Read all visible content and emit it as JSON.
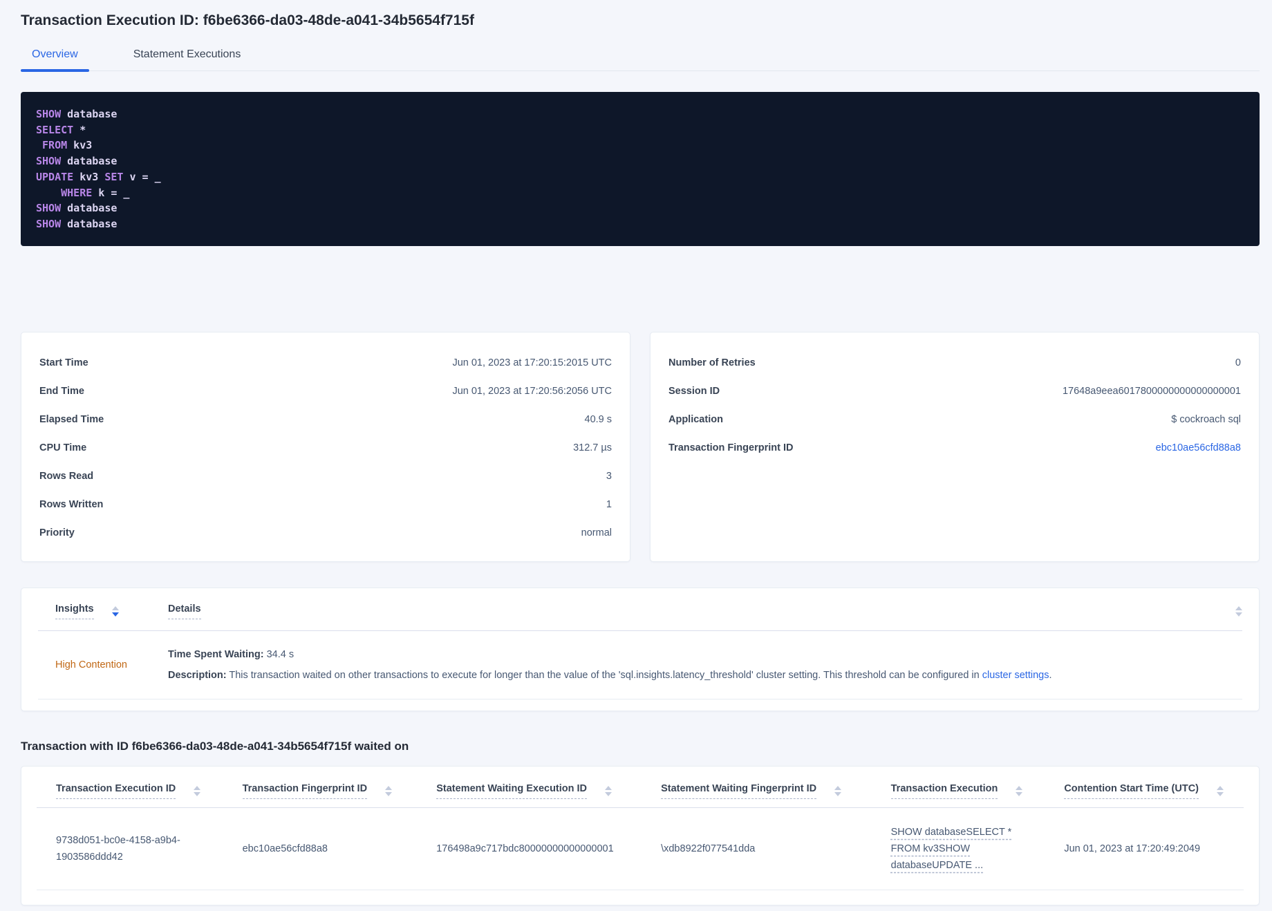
{
  "header": {
    "title": "Transaction Execution ID: f6be6366-da03-48de-a041-34b5654f715f"
  },
  "tabs": {
    "overview": "Overview",
    "statement_executions": "Statement Executions"
  },
  "sql": {
    "lines": [
      [
        {
          "text": "SHOW",
          "type": "kw"
        },
        {
          "text": " database",
          "type": "id"
        }
      ],
      [
        {
          "text": "SELECT",
          "type": "kw"
        },
        {
          "text": " *",
          "type": "id"
        }
      ],
      [
        {
          "text": " ",
          "type": "id"
        },
        {
          "text": "FROM",
          "type": "kw"
        },
        {
          "text": " kv3",
          "type": "id"
        }
      ],
      [
        {
          "text": "SHOW",
          "type": "kw"
        },
        {
          "text": " database",
          "type": "id"
        }
      ],
      [
        {
          "text": "UPDATE",
          "type": "kw"
        },
        {
          "text": " kv3 ",
          "type": "id"
        },
        {
          "text": "SET",
          "type": "kw"
        },
        {
          "text": " v = _",
          "type": "id"
        }
      ],
      [
        {
          "text": "    ",
          "type": "id"
        },
        {
          "text": "WHERE",
          "type": "kw"
        },
        {
          "text": " k = _",
          "type": "id"
        }
      ],
      [
        {
          "text": "SHOW",
          "type": "kw"
        },
        {
          "text": " database",
          "type": "id"
        }
      ],
      [
        {
          "text": "SHOW",
          "type": "kw"
        },
        {
          "text": " database",
          "type": "id"
        }
      ]
    ]
  },
  "summary": {
    "left": {
      "rows": [
        {
          "label": "Start Time",
          "value": "Jun 01, 2023 at 17:20:15:2015 UTC"
        },
        {
          "label": "End Time",
          "value": "Jun 01, 2023 at 17:20:56:2056 UTC"
        },
        {
          "label": "Elapsed Time",
          "value": "40.9 s"
        },
        {
          "label": "CPU Time",
          "value": "312.7 µs"
        },
        {
          "label": "Rows Read",
          "value": "3"
        },
        {
          "label": "Rows Written",
          "value": "1"
        },
        {
          "label": "Priority",
          "value": "normal"
        }
      ]
    },
    "right": {
      "rows": [
        {
          "label": "Number of Retries",
          "value": "0"
        },
        {
          "label": "Session ID",
          "value": "17648a9eea6017800000000000000001"
        },
        {
          "label": "Application",
          "value": "$ cockroach sql"
        },
        {
          "label": "Transaction Fingerprint ID",
          "value": "ebc10ae56cfd88a8"
        }
      ]
    }
  },
  "insights": {
    "columns": {
      "insights": "Insights",
      "details": "Details"
    },
    "row": {
      "insight": "High Contention",
      "waiting_label": "Time Spent Waiting:",
      "waiting_value": " 34.4 s",
      "description_label": "Description:",
      "description_text": " This transaction waited on other transactions to execute for longer than the value of the 'sql.insights.latency_threshold' cluster setting. This threshold can be configured in ",
      "description_link": "cluster settings",
      "description_end": "."
    }
  },
  "waited_on": {
    "heading": "Transaction with ID f6be6366-da03-48de-a041-34b5654f715f waited on",
    "columns": [
      "Transaction Execution ID",
      "Transaction Fingerprint ID",
      "Statement Waiting Execution ID",
      "Statement Waiting Fingerprint ID",
      "Transaction Execution",
      "Contention Start Time (UTC)"
    ],
    "rows": [
      {
        "transaction_execution_id": "9738d051-bc0e-4158-a9b4-1903586ddd42",
        "transaction_fingerprint_id": "ebc10ae56cfd88a8",
        "statement_waiting_execution_id": "176498a9c717bdc80000000000000001",
        "statement_waiting_fingerprint_id": "\\xdb8922f077541dda",
        "transaction_execution": "SHOW databaseSELECT * FROM kv3SHOW databaseUPDATE ...",
        "contention_start_time": "Jun 01, 2023 at 17:20:49:2049"
      }
    ]
  },
  "colors": {
    "accent_blue": "#2a66e4",
    "contention_orange": "#c06714",
    "code_background": "#0e1729",
    "code_keyword": "#b886e8",
    "code_identifier": "#dcd5f2",
    "page_background": "#f4f6fb"
  }
}
